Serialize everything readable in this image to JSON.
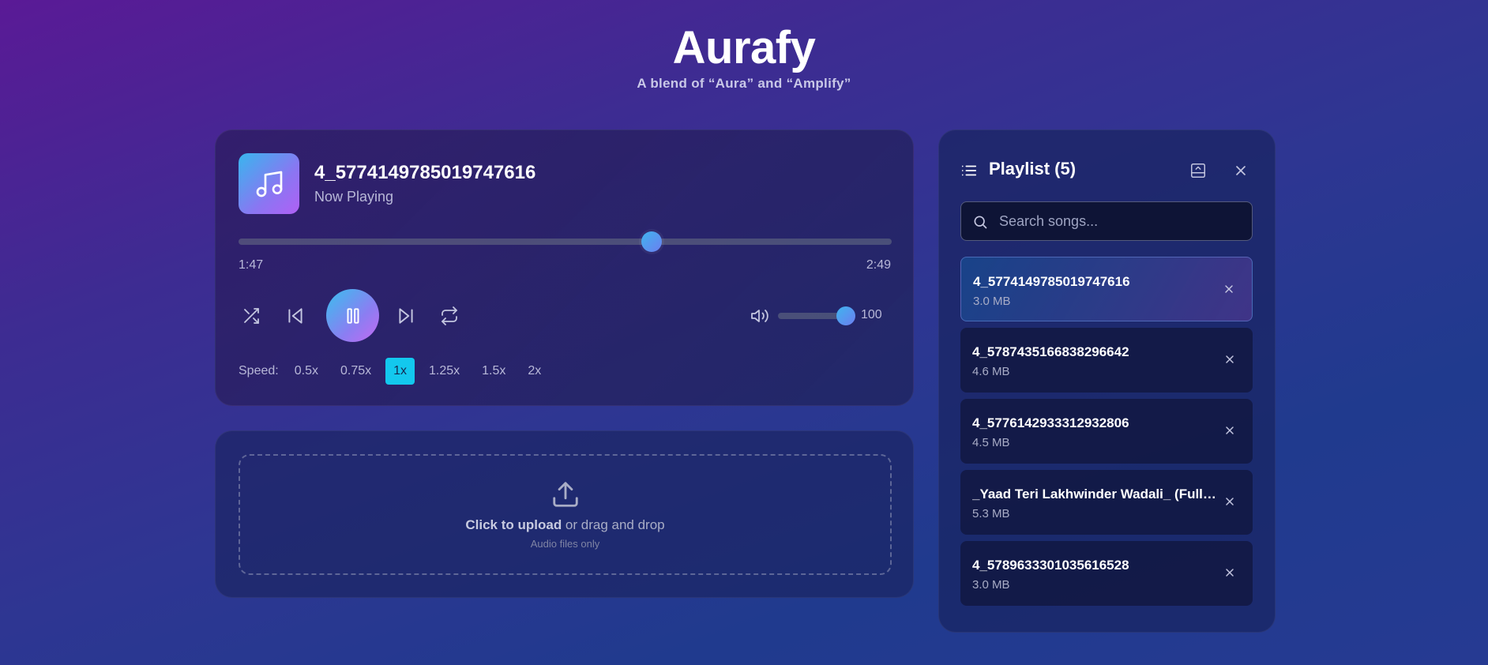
{
  "app": {
    "title": "Aurafy",
    "subtitle": "A blend of “Aura” and “Amplify”"
  },
  "player": {
    "track_title": "4_5774149785019747616",
    "status": "Now Playing",
    "current_time": "1:47",
    "total_time": "2:49",
    "progress_fraction": 0.633,
    "is_playing": true,
    "volume": "100",
    "volume_fraction": 1.0,
    "speed_label": "Speed:",
    "speeds": [
      "0.5x",
      "0.75x",
      "1x",
      "1.25x",
      "1.5x",
      "2x"
    ],
    "active_speed": "1x",
    "icons": [
      "music-note-icon",
      "shuffle-icon",
      "skip-back-icon",
      "pause-icon",
      "skip-forward-icon",
      "repeat-icon",
      "volume-icon"
    ]
  },
  "uploader": {
    "text_bold": "Click to upload",
    "text_rest": " or drag and drop",
    "hint": "Audio files only",
    "icon": "upload-icon"
  },
  "playlist": {
    "title": "Playlist (5)",
    "search_placeholder": "Search songs...",
    "icons": [
      "list-icon",
      "collapse-icon",
      "close-icon",
      "search-icon",
      "remove-icon"
    ],
    "songs": [
      {
        "name": "4_5774149785019747616",
        "size": "3.0 MB",
        "active": true
      },
      {
        "name": "4_5787435166838296642",
        "size": "4.6 MB",
        "active": false
      },
      {
        "name": "4_5776142933312932806",
        "size": "4.5 MB",
        "active": false
      },
      {
        "name": "_Yaad Teri Lakhwinder Wadali_ (Full Video) _ Gulzar Ch",
        "size": "5.3 MB",
        "active": false
      },
      {
        "name": "4_5789633301035616528",
        "size": "3.0 MB",
        "active": false
      }
    ]
  },
  "colors": {
    "accent": "#13c8ee",
    "gradient_start": "#39c0ee",
    "gradient_end": "#c46af2"
  }
}
